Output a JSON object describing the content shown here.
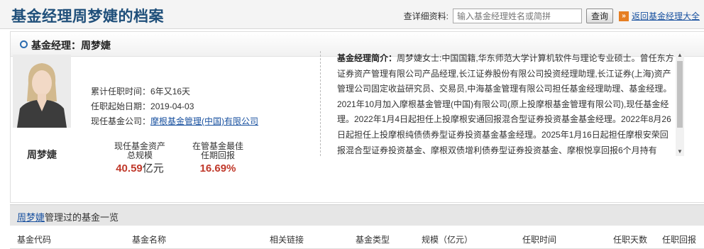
{
  "header": {
    "title": "基金经理周梦婕的档案",
    "search_label": "查详细资料:",
    "search_placeholder": "输入基金经理姓名或简拼",
    "search_button": "查询",
    "back_icon": "double-chevron-right-icon",
    "back_link": "返回基金经理大全"
  },
  "manager": {
    "heading": "基金经理：周梦婕",
    "name": "周梦婕",
    "tenure_label": "累计任职时间：",
    "tenure_value": "6年又16天",
    "start_label": "任职起始日期：",
    "start_value": "2019-04-03",
    "company_label": "现任基金公司：",
    "company_value": "摩根基金管理(中国)有限公司",
    "aum_label_1": "现任基金资产",
    "aum_label_2": "总规模",
    "aum_value": "40.59",
    "aum_unit": "亿元",
    "best_label_1": "在管基金最佳",
    "best_label_2": "任期回报",
    "best_value": "16.69%"
  },
  "intro": {
    "label": "基金经理简介：",
    "text": "周梦婕女士:中国国籍,华东师范大学计算机软件与理论专业硕士。曾任东方证券资产管理有限公司产品经理,长江证券股份有限公司投资经理助理,长江证券(上海)资产管理公司固定收益研究员、交易员,中海基金管理有限公司担任基金经理助理、基金经理。2021年10月加入摩根基金管理(中国)有限公司(原上投摩根基金管理有限公司),现任基金经理。2022年1月4日起担任上投摩根安通回报混合型证券投资基金基金经理。2022年8月26日起担任上投摩根纯债债券型证券投资基金基金经理。2025年1月16日起担任摩根安荣回报混合型证券投资基金、摩根双债增利债券型证券投资基金、摩根悦享回报6个月持有"
  },
  "fund_list": {
    "name_link": "周梦婕",
    "title_suffix": "管理过的基金一览",
    "columns": [
      "基金代码",
      "基金名称",
      "相关链接",
      "基金类型",
      "规模（亿元）",
      "任职时间",
      "任职天数",
      "任职回报"
    ]
  },
  "colors": {
    "title_blue": "#1f4f7a",
    "link_blue": "#1a52a0",
    "value_red": "#c0392b",
    "accent_orange": "#e67e22"
  }
}
